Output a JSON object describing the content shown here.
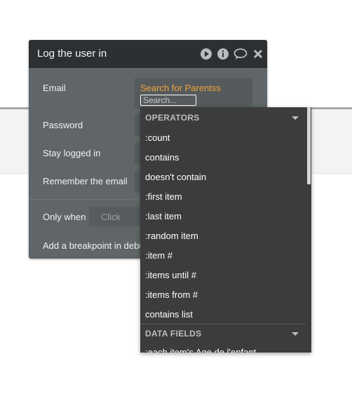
{
  "panel": {
    "title": "Log the user in",
    "icons": [
      "play-icon",
      "info-icon",
      "comment-icon",
      "close-icon"
    ],
    "rows": {
      "email_label": "Email",
      "email_value": "Search for Parentss",
      "search_placeholder": "Search...",
      "password_label": "Password",
      "stay_logged_in_label": "Stay logged in",
      "remember_email_label": "Remember the email",
      "only_when_label": "Only when",
      "only_when_placeholder": "Click",
      "breakpoint_label": "Add a breakpoint in debu"
    }
  },
  "dropdown": {
    "operators_title": "OPERATORS",
    "operators": [
      ":count",
      "contains",
      "doesn't contain",
      ":first item",
      ":last item",
      ":random item",
      ":item #",
      ":items until #",
      ":items from #",
      "contains list"
    ],
    "data_fields_title": "DATA FIELDS",
    "data_fields": [
      ":each item's Age de l'enfant"
    ]
  },
  "colors": {
    "header": "#2c3033",
    "panel": "#5f6568",
    "accent": "#f0a43a",
    "dropdown": "#3c3c3c"
  }
}
